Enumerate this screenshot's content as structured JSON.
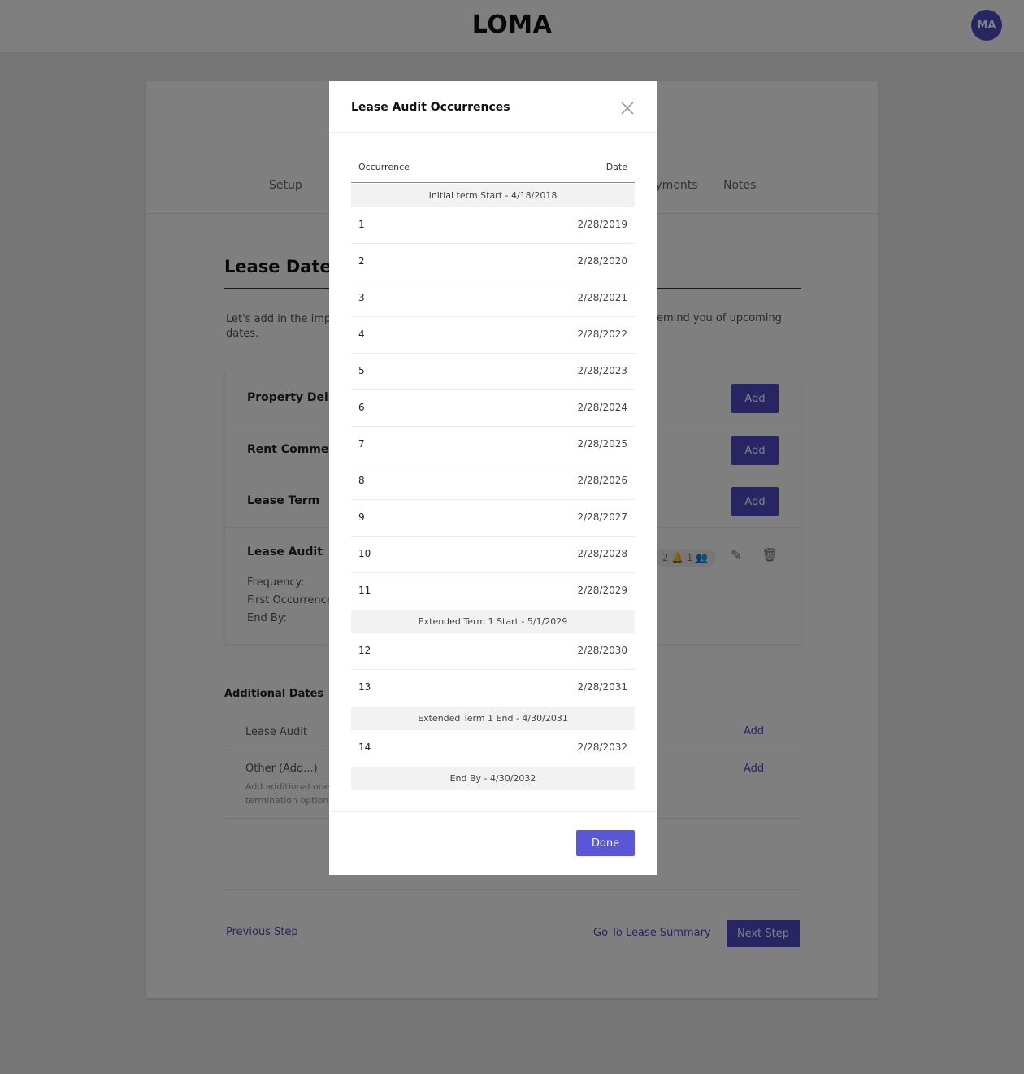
{
  "header": {
    "brand": "LOMA",
    "avatar_initials": "MA"
  },
  "steps": {
    "setup": "Setup",
    "payments": "Payments",
    "notes": "Notes"
  },
  "lease_dates": {
    "title": "Lease Dates",
    "intro_start": "Let's add in the impo",
    "intro_start_2": "dates.",
    "intro_end": "emind you of upcoming",
    "rows": [
      {
        "label": "Property Deliv",
        "button": "Add"
      },
      {
        "label": "Rent Commen",
        "button": "Add"
      },
      {
        "label": "Lease Term",
        "button": "Add"
      },
      {
        "label": "Lease Audit",
        "frequency": "Frequency:",
        "first_occurrence": "First Occurrence",
        "end_by": "End By:",
        "chip": "2 🔔 1 👥"
      }
    ]
  },
  "additional": {
    "title": "Additional Dates",
    "rows": [
      {
        "label": "Lease Audit",
        "link": "Add"
      },
      {
        "label": "Other (Add...)",
        "desc": "Add additional one termination option",
        "link": "Add"
      }
    ]
  },
  "footer": {
    "previous": "Previous Step",
    "summary": "Go To Lease Summary",
    "next": "Next Step"
  },
  "modal": {
    "title": "Lease Audit Occurrences",
    "col_occurrence": "Occurrence",
    "col_date": "Date",
    "done": "Done",
    "rows": [
      {
        "type": "term",
        "text": "Initial term Start - 4/18/2018"
      },
      {
        "type": "occ",
        "num": "1",
        "date": "2/28/2019"
      },
      {
        "type": "occ",
        "num": "2",
        "date": "2/28/2020"
      },
      {
        "type": "occ",
        "num": "3",
        "date": "2/28/2021"
      },
      {
        "type": "occ",
        "num": "4",
        "date": "2/28/2022"
      },
      {
        "type": "occ",
        "num": "5",
        "date": "2/28/2023"
      },
      {
        "type": "occ",
        "num": "6",
        "date": "2/28/2024"
      },
      {
        "type": "occ",
        "num": "7",
        "date": "2/28/2025"
      },
      {
        "type": "occ",
        "num": "8",
        "date": "2/28/2026"
      },
      {
        "type": "occ",
        "num": "9",
        "date": "2/28/2027"
      },
      {
        "type": "occ",
        "num": "10",
        "date": "2/28/2028"
      },
      {
        "type": "occ",
        "num": "11",
        "date": "2/28/2029"
      },
      {
        "type": "term",
        "text": "Extended Term 1 Start - 5/1/2029"
      },
      {
        "type": "occ",
        "num": "12",
        "date": "2/28/2030"
      },
      {
        "type": "occ",
        "num": "13",
        "date": "2/28/2031"
      },
      {
        "type": "term",
        "text": "Extended Term 1 End - 4/30/2031"
      },
      {
        "type": "occ",
        "num": "14",
        "date": "2/28/2032"
      },
      {
        "type": "term",
        "text": "End By - 4/30/2032"
      }
    ]
  }
}
